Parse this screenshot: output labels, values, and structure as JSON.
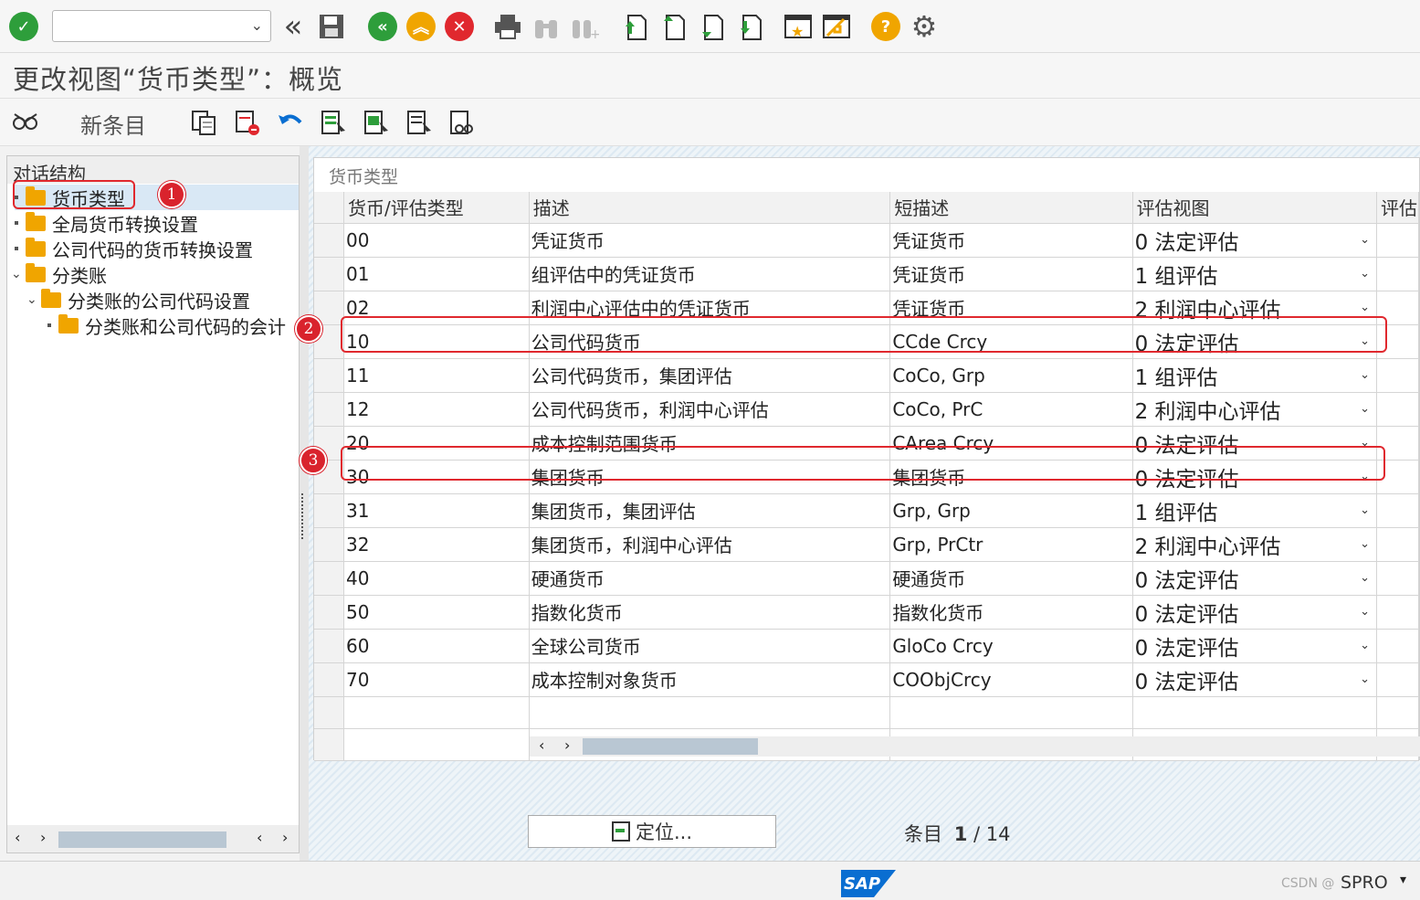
{
  "toolbar": {
    "command_field_value": "",
    "icons": [
      "enter-icon",
      "back-icon",
      "save-icon",
      "back-green-icon",
      "exit-icon",
      "cancel-icon",
      "print-icon",
      "find-icon",
      "find-next-icon",
      "first-page-icon",
      "previous-page-icon",
      "next-page-icon",
      "last-page-icon",
      "create-session-icon",
      "shortcut-icon",
      "help-icon",
      "settings-icon"
    ]
  },
  "title": "更改视图“货币类型”：概览",
  "app_toolbar": {
    "new_entries_label": "新条目"
  },
  "tree": {
    "header": "对话结构",
    "items": [
      {
        "label": "货币类型",
        "level": 0,
        "selected": true
      },
      {
        "label": "全局货币转换设置",
        "level": 0
      },
      {
        "label": "公司代码的货币转换设置",
        "level": 0
      },
      {
        "label": "分类账",
        "level": 0,
        "expanded": true
      },
      {
        "label": "分类账的公司代码设置",
        "level": 1,
        "expanded": true
      },
      {
        "label": "分类账和公司代码的会计",
        "level": 2
      }
    ]
  },
  "table": {
    "title": "货币类型",
    "columns": [
      "货币/评估类型",
      "描述",
      "短描述",
      "评估视图",
      "评估"
    ],
    "rows": [
      {
        "type": "00",
        "desc": "凭证货币",
        "short": "凭证货币",
        "view": "0 法定评估"
      },
      {
        "type": "01",
        "desc": "组评估中的凭证货币",
        "short": "凭证货币",
        "view": "1 组评估"
      },
      {
        "type": "02",
        "desc": "利润中心评估中的凭证货币",
        "short": "凭证货币",
        "view": "2 利润中心评估"
      },
      {
        "type": "10",
        "desc": "公司代码货币",
        "short": "CCde Crcy",
        "view": "0 法定评估"
      },
      {
        "type": "11",
        "desc": "公司代码货币，集团评估",
        "short": "CoCo, Grp",
        "view": "1 组评估"
      },
      {
        "type": "12",
        "desc": "公司代码货币，利润中心评估",
        "short": "CoCo, PrC",
        "view": "2 利润中心评估"
      },
      {
        "type": "20",
        "desc": "成本控制范围货币",
        "short": "CArea Crcy",
        "view": "0 法定评估"
      },
      {
        "type": "30",
        "desc": "集团货币",
        "short": "集团货币",
        "view": "0 法定评估"
      },
      {
        "type": "31",
        "desc": "集团货币，集团评估",
        "short": "Grp, Grp",
        "view": "1 组评估"
      },
      {
        "type": "32",
        "desc": "集团货币，利润中心评估",
        "short": "Grp, PrCtr",
        "view": "2 利润中心评估"
      },
      {
        "type": "40",
        "desc": "硬通货币",
        "short": "硬通货币",
        "view": "0 法定评估"
      },
      {
        "type": "50",
        "desc": "指数化货币",
        "short": "指数化货币",
        "view": "0 法定评估"
      },
      {
        "type": "60",
        "desc": "全球公司货币",
        "short": "GloCo Crcy",
        "view": "0 法定评估"
      },
      {
        "type": "70",
        "desc": "成本控制对象货币",
        "short": "COObjCrcy",
        "view": "0 法定评估"
      }
    ]
  },
  "annotations": [
    "1",
    "2",
    "3"
  ],
  "footer": {
    "locate_label": "定位...",
    "entry_label": "条目",
    "entry_current": "1",
    "entry_sep": " / ",
    "entry_total": "14"
  },
  "status": {
    "tcode": "SPRO",
    "watermark": "CSDN @"
  },
  "colors": {
    "highlight": "#e0282e",
    "badge": "#d9232d",
    "folder": "#f0a500",
    "sap_blue": "#0a6ed1"
  }
}
